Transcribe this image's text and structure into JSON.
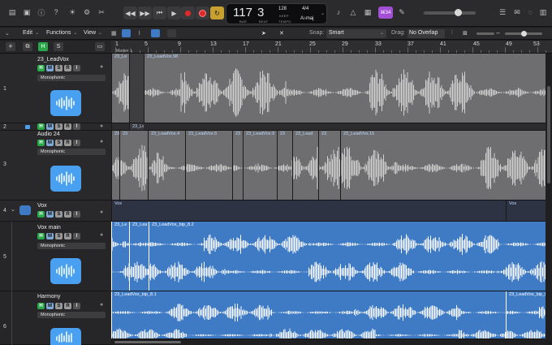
{
  "transport": {
    "position": "117",
    "beat": "3",
    "position_label": "BAR",
    "beat_label": "BEAT",
    "tempo": "128",
    "tempo_label": "KEEP",
    "tempo_sub": "TEMPO",
    "signature": "4/4",
    "key": "A♭maj",
    "key_badge": "⌘34"
  },
  "menu": {
    "edit": "Edit",
    "functions": "Functions",
    "view": "View",
    "snap_label": "Snap:",
    "snap_value": "Smart",
    "drag_label": "Drag:",
    "drag_value": "No Overlap"
  },
  "track_header": {
    "h_label": "H",
    "s_label": "S"
  },
  "ruler": {
    "marks": [
      "1",
      "5",
      "9",
      "13",
      "17",
      "21",
      "25",
      "29",
      "33",
      "37",
      "41",
      "45",
      "49",
      "53"
    ],
    "marker": "Marker 1"
  },
  "tracks": [
    {
      "number": "1",
      "name": "23_LeadVox",
      "mode": "Monophonic"
    },
    {
      "number": "2",
      "name": "",
      "mode": ""
    },
    {
      "number": "3",
      "name": "Audio 24",
      "mode": "Monophonic"
    },
    {
      "number": "4",
      "name": "Vox",
      "mode": ""
    },
    {
      "number": "5",
      "name": "Vox main",
      "mode": "Monophonic"
    },
    {
      "number": "6",
      "name": "Harmony",
      "mode": "Monophonic"
    }
  ],
  "buttons": {
    "h": "H",
    "m": "M",
    "s": "S",
    "r": "R",
    "i": "I"
  },
  "regions": {
    "lane1": [
      "23_Le",
      "23_LeadVox.98"
    ],
    "lane3": [
      "23",
      "23_LeadVox.4",
      "23_LeadVox.5",
      "23",
      "23_LeadVox.9",
      "23",
      "23_Lead",
      "23",
      "23_LeadVox.15"
    ],
    "lane4": [
      "Vox",
      "Vox"
    ],
    "lane5": [
      "23_Le",
      "23_Lea",
      "23_LeadVox_bip_8.2"
    ],
    "lane6": [
      "23_LeadVox_bip_8.1",
      "23_LeadVox_bip_8"
    ],
    "lane2": [
      "23_Le"
    ]
  },
  "colors": {
    "audio_region": "#6e6e70",
    "audio_wave": "#d0d0d0",
    "selected_region": "#3f7ac4",
    "selected_wave": "#ffffff",
    "key_badge": "#a24fd6",
    "record": "#e02a2a"
  }
}
